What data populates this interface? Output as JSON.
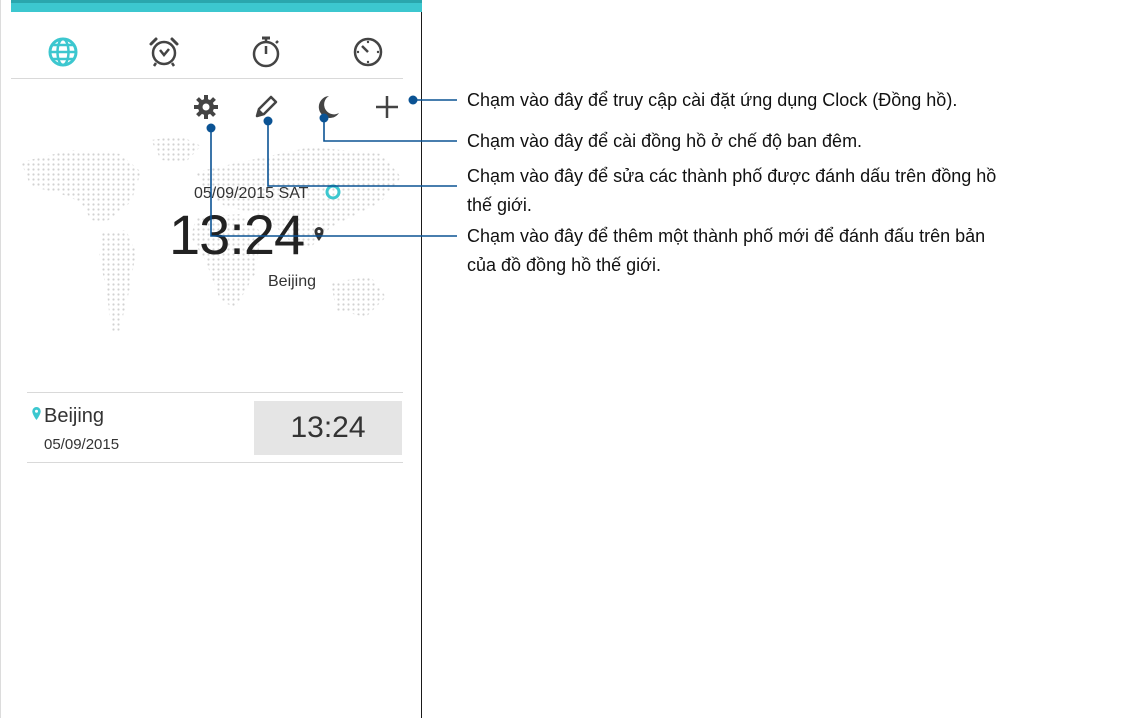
{
  "tabs": [
    {
      "icon": "globe-icon"
    },
    {
      "icon": "alarm-icon"
    },
    {
      "icon": "stopwatch-icon"
    },
    {
      "icon": "timer-icon"
    }
  ],
  "actions": [
    {
      "icon": "gear-icon"
    },
    {
      "icon": "pencil-icon"
    },
    {
      "icon": "moon-icon"
    },
    {
      "icon": "plus-icon"
    }
  ],
  "clock": {
    "date": "05/09/2015 SAT",
    "time": "13:24",
    "city": "Beijing"
  },
  "cities": [
    {
      "name": "Beijing",
      "date": "05/09/2015",
      "time": "13:24"
    }
  ],
  "callouts": [
    "Chạm vào đây để truy cập cài đặt ứng dụng Clock (Đồng hồ).",
    "Chạm vào đây để cài đồng hồ ở chế độ ban đêm.",
    "Chạm vào đây để sửa các thành phố được đánh dấu trên đồng hồ",
    "thế giới.",
    "Chạm vào đây để thêm một thành phố mới để đánh đấu trên bản",
    "của đồ đồng hồ thế giới."
  ],
  "colors": {
    "accent": "#3cc7cf",
    "callout_line": "#0b5394",
    "icon": "#444444"
  }
}
